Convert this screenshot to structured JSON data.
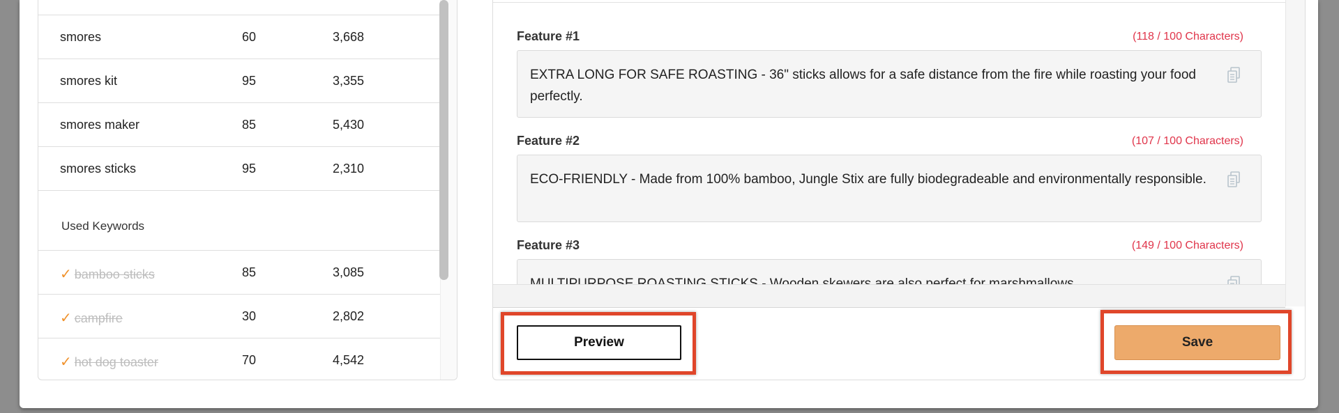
{
  "keywords": {
    "rows": [
      {
        "name": "smores",
        "score": "60",
        "volume": "3,668"
      },
      {
        "name": "smores kit",
        "score": "95",
        "volume": "3,355"
      },
      {
        "name": "smores maker",
        "score": "85",
        "volume": "5,430"
      },
      {
        "name": "smores sticks",
        "score": "95",
        "volume": "2,310"
      }
    ],
    "used_heading": "Used Keywords",
    "used_rows": [
      {
        "name": "bamboo sticks",
        "score": "85",
        "volume": "3,085"
      },
      {
        "name": "campfire",
        "score": "30",
        "volume": "2,802"
      },
      {
        "name": "hot dog toaster",
        "score": "70",
        "volume": "4,542"
      }
    ],
    "check_glyph": "✓"
  },
  "features": [
    {
      "label": "Feature #1",
      "count": "(118 / 100 Characters)",
      "text": "EXTRA LONG FOR SAFE ROASTING - 36\" sticks allows for a safe distance from the fire while roasting your food perfectly."
    },
    {
      "label": "Feature #2",
      "count": "(107 / 100 Characters)",
      "text": "ECO-FRIENDLY - Made from 100% bamboo, Jungle Stix are fully biodegradeable and environmentally responsible."
    },
    {
      "label": "Feature #3",
      "count": "(149 / 100 Characters)",
      "text": "MULTIPURPOSE ROASTING STICKS - Wooden skewers are also perfect for marshmallows,"
    }
  ],
  "actions": {
    "preview_label": "Preview",
    "save_label": "Save"
  },
  "colors": {
    "accent_orange": "#edaa6b",
    "over_limit_red": "#e0344a",
    "highlight_red": "#e0462a"
  }
}
